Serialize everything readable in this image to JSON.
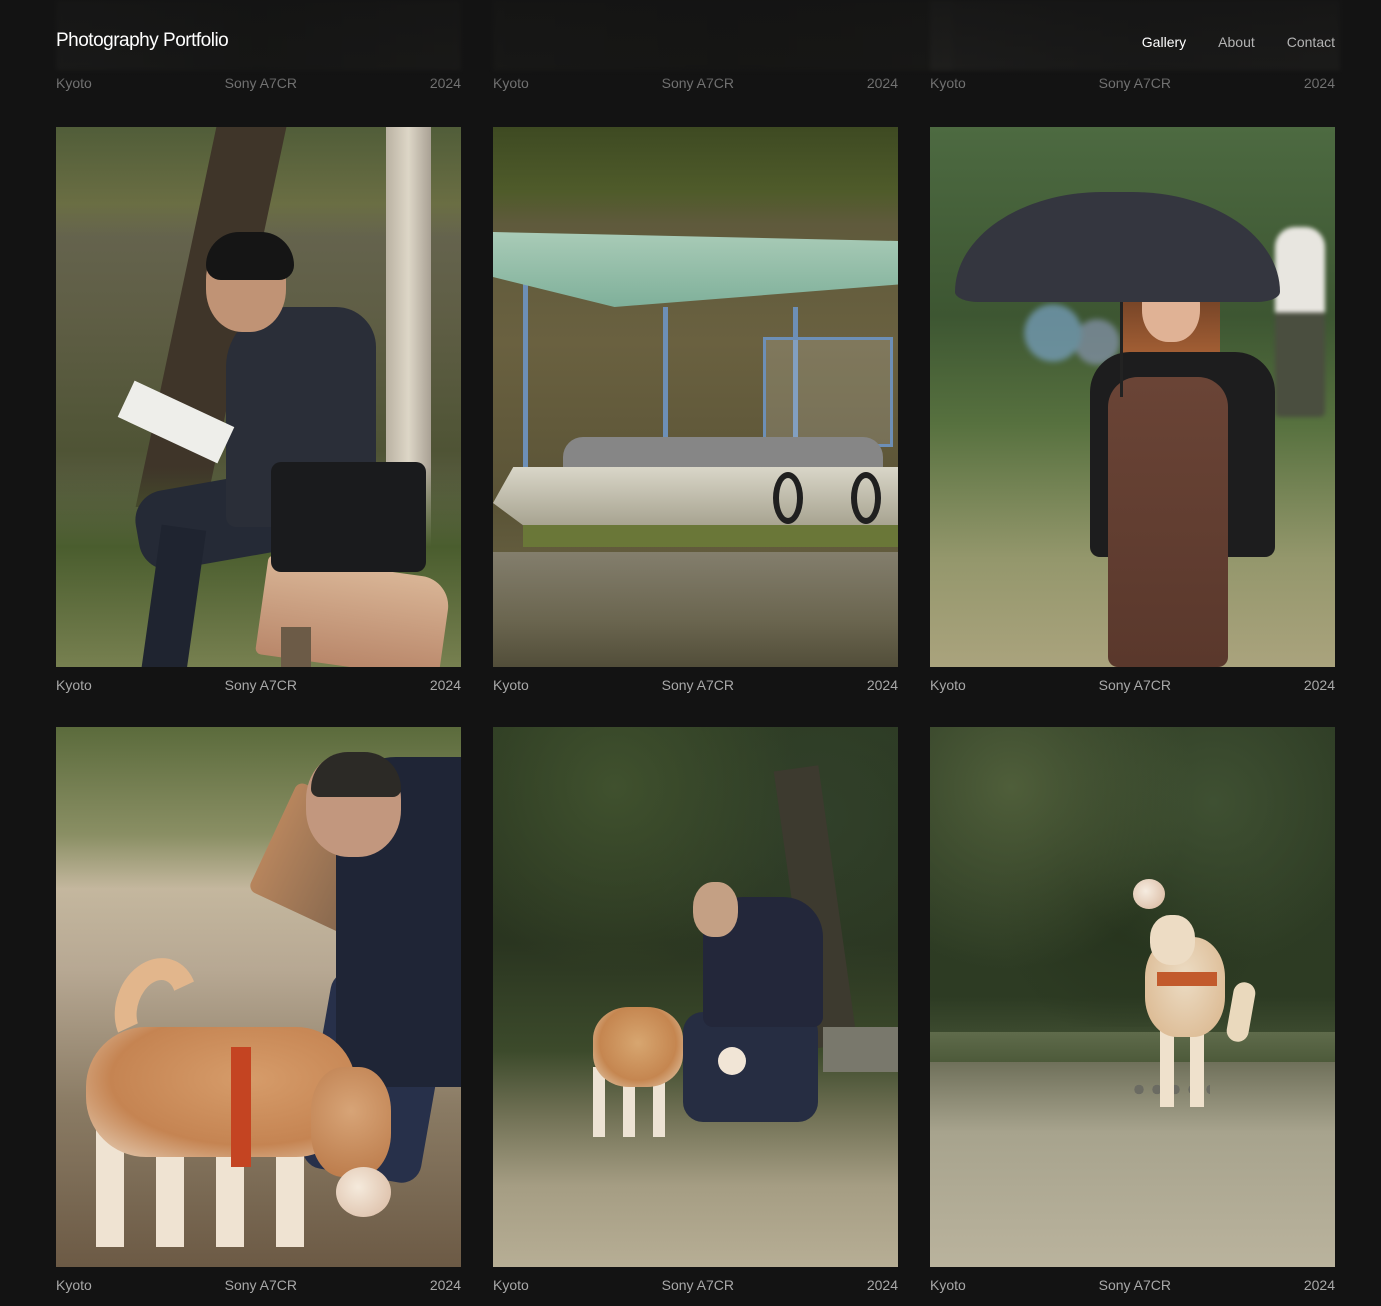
{
  "header": {
    "brand": "Photography Portfolio",
    "nav": [
      {
        "label": "Gallery",
        "active": true
      },
      {
        "label": "About",
        "active": false
      },
      {
        "label": "Contact",
        "active": false
      }
    ]
  },
  "previous_row_captions": [
    {
      "location": "Kyoto",
      "camera": "Sony A7CR",
      "year": "2024"
    },
    {
      "location": "Kyoto",
      "camera": "Sony A7CR",
      "year": "2024"
    },
    {
      "location": "Kyoto",
      "camera": "Sony A7CR",
      "year": "2024"
    }
  ],
  "gallery": [
    {
      "location": "Kyoto",
      "camera": "Sony A7CR",
      "year": "2024"
    },
    {
      "location": "Kyoto",
      "camera": "Sony A7CR",
      "year": "2024"
    },
    {
      "location": "Kyoto",
      "camera": "Sony A7CR",
      "year": "2024"
    },
    {
      "location": "Kyoto",
      "camera": "Sony A7CR",
      "year": "2024"
    },
    {
      "location": "Kyoto",
      "camera": "Sony A7CR",
      "year": "2024"
    },
    {
      "location": "Kyoto",
      "camera": "Sony A7CR",
      "year": "2024"
    }
  ]
}
